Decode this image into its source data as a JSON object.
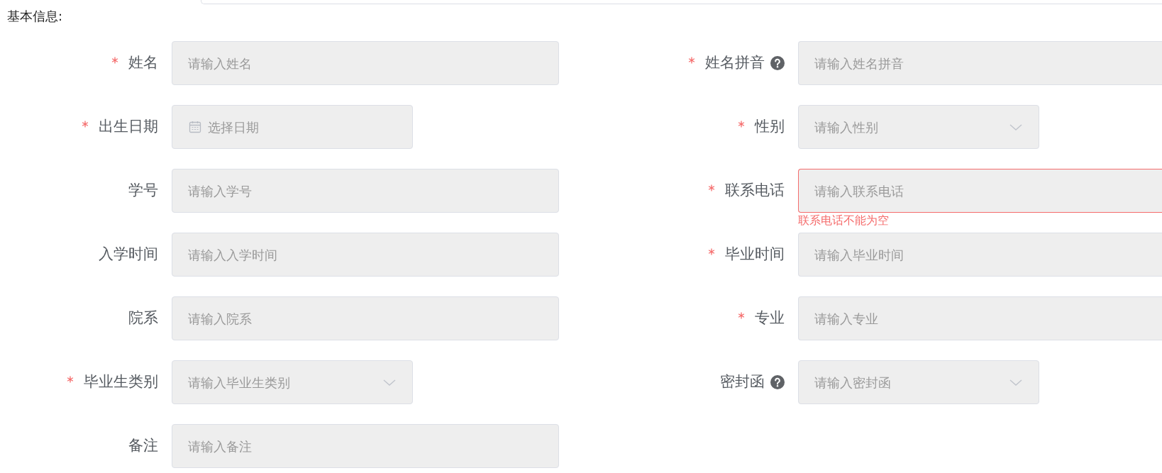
{
  "section_title": "基本信息:",
  "rows": [
    {
      "left": {
        "label": "姓名",
        "required": true,
        "kind": "text",
        "placeholder": "请输入姓名"
      },
      "right": {
        "label": "姓名拼音",
        "required": true,
        "help": true,
        "kind": "text",
        "placeholder": "请输入姓名拼音"
      }
    },
    {
      "left": {
        "label": "出生日期",
        "required": true,
        "kind": "date",
        "placeholder": "选择日期"
      },
      "right": {
        "label": "性别",
        "required": true,
        "kind": "select",
        "placeholder": "请输入性别"
      }
    },
    {
      "left": {
        "label": "学号",
        "required": false,
        "kind": "text",
        "placeholder": "请输入学号"
      },
      "right": {
        "label": "联系电话",
        "required": true,
        "kind": "text",
        "placeholder": "请输入联系电话",
        "error": "联系电话不能为空"
      }
    },
    {
      "left": {
        "label": "入学时间",
        "required": false,
        "kind": "text",
        "placeholder": "请输入入学时间"
      },
      "right": {
        "label": "毕业时间",
        "required": true,
        "kind": "text",
        "placeholder": "请输入毕业时间"
      }
    },
    {
      "left": {
        "label": "院系",
        "required": false,
        "kind": "text",
        "placeholder": "请输入院系"
      },
      "right": {
        "label": "专业",
        "required": true,
        "kind": "text",
        "placeholder": "请输入专业"
      }
    },
    {
      "left": {
        "label": "毕业生类别",
        "required": true,
        "kind": "select",
        "placeholder": "请输入毕业生类别"
      },
      "right": {
        "label": "密封函",
        "required": false,
        "help": true,
        "kind": "select",
        "placeholder": "请输入密封函"
      }
    },
    {
      "left": {
        "label": "备注",
        "required": false,
        "kind": "text",
        "placeholder": "请输入备注"
      }
    }
  ]
}
